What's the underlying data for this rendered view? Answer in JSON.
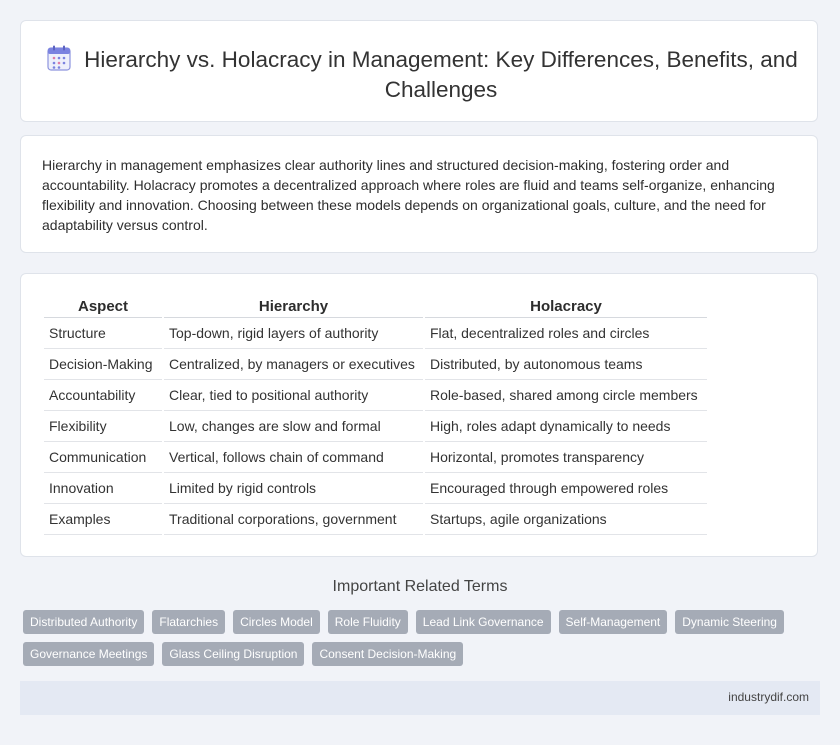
{
  "header": {
    "title": "Hierarchy vs. Holacracy in Management: Key Differences, Benefits, and Challenges",
    "icon": "calendar-icon"
  },
  "summary": {
    "text": "Hierarchy in management emphasizes clear authority lines and structured decision-making, fostering order and accountability. Holacracy promotes a decentralized approach where roles are fluid and teams self-organize, enhancing flexibility and innovation. Choosing between these models depends on organizational goals, culture, and the need for adaptability versus control."
  },
  "table": {
    "headers": [
      "Aspect",
      "Hierarchy",
      "Holacracy"
    ],
    "rows": [
      [
        "Structure",
        "Top-down, rigid layers of authority",
        "Flat, decentralized roles and circles"
      ],
      [
        "Decision-Making",
        "Centralized, by managers or executives",
        "Distributed, by autonomous teams"
      ],
      [
        "Accountability",
        "Clear, tied to positional authority",
        "Role-based, shared among circle members"
      ],
      [
        "Flexibility",
        "Low, changes are slow and formal",
        "High, roles adapt dynamically to needs"
      ],
      [
        "Communication",
        "Vertical, follows chain of command",
        "Horizontal, promotes transparency"
      ],
      [
        "Innovation",
        "Limited by rigid controls",
        "Encouraged through empowered roles"
      ],
      [
        "Examples",
        "Traditional corporations, government",
        "Startups, agile organizations"
      ]
    ]
  },
  "related": {
    "title": "Important Related Terms",
    "tags": [
      "Distributed Authority",
      "Flatarchies",
      "Circles Model",
      "Role Fluidity",
      "Lead Link Governance",
      "Self-Management",
      "Dynamic Steering",
      "Governance Meetings",
      "Glass Ceiling Disruption",
      "Consent Decision-Making"
    ]
  },
  "footer": {
    "site": "industrydif.com"
  },
  "colors": {
    "background": "#f1f3f8",
    "tag": "#a5abb6",
    "footer": "#e4e9f3",
    "icon_accent": "#7b83e0"
  }
}
